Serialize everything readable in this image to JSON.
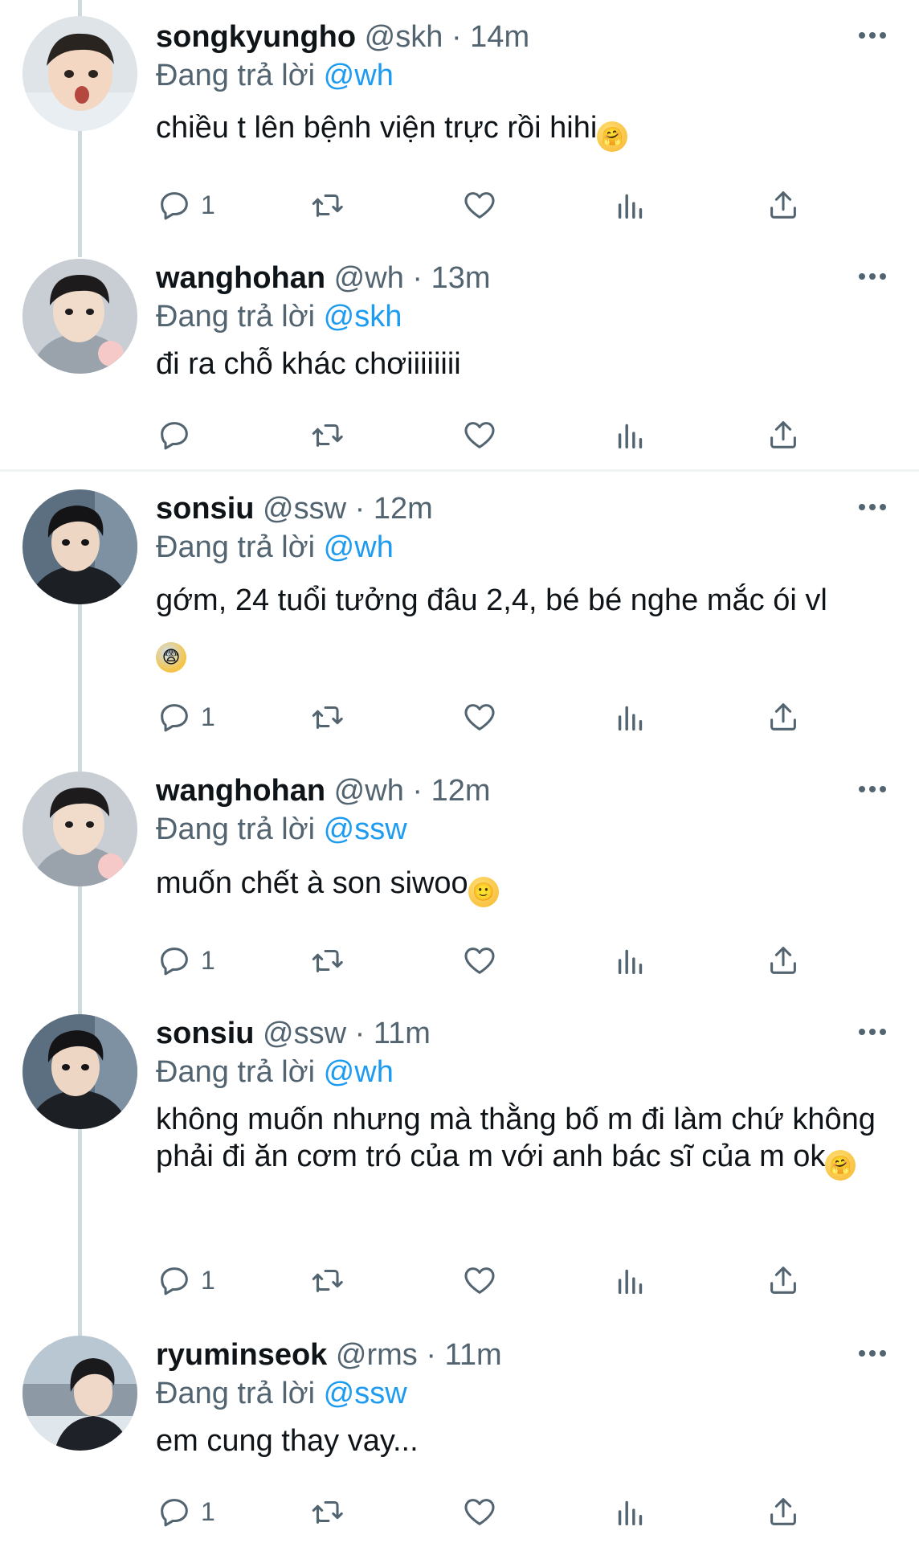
{
  "reply_prefix": "Đang trả lời",
  "accent_color": "#1d9bf0",
  "tweets": [
    {
      "display_name": "songkyungho",
      "handle": "@skh",
      "separator": "·",
      "time": "14m",
      "reply_to": "@wh",
      "text": "chiều t lên bệnh viện trực rồi hihi",
      "emoji": "hugging-face",
      "reply_count": "1"
    },
    {
      "display_name": "wanghohan",
      "handle": "@wh",
      "separator": "·",
      "time": "13m",
      "reply_to": "@skh",
      "text": "đi ra chỗ khác chơiiiiiiii",
      "reply_count": ""
    },
    {
      "display_name": "sonsiu",
      "handle": "@ssw",
      "separator": "·",
      "time": "12m",
      "reply_to": "@wh",
      "text": "gớm, 24 tuổi tưởng đâu 2,4, bé bé nghe mắc ói vl",
      "emoji": "fearful-face",
      "reply_count": "1"
    },
    {
      "display_name": "wanghohan",
      "handle": "@wh",
      "separator": "·",
      "time": "12m",
      "reply_to": "@ssw",
      "text": "muốn chết à son siwoo",
      "emoji": "slightly-smiling-face",
      "reply_count": "1"
    },
    {
      "display_name": "sonsiu",
      "handle": "@ssw",
      "separator": "·",
      "time": "11m",
      "reply_to": "@wh",
      "text": "không muốn nhưng mà thằng bố m đi làm chứ không phải đi ăn cơm tró của m với anh bác sĩ của m ok",
      "emoji": "hugging-face",
      "reply_count": "1"
    },
    {
      "display_name": "ryuminseok",
      "handle": "@rms",
      "separator": "·",
      "time": "11m",
      "reply_to": "@ssw",
      "text": "em cung thay vay...",
      "reply_count": "1"
    }
  ]
}
